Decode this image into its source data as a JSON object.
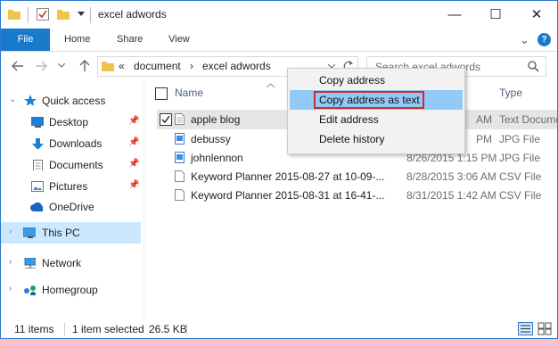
{
  "window": {
    "title": "excel adwords",
    "minimize_glyph": "—",
    "maximize_glyph": "☐",
    "close_glyph": "✕"
  },
  "ribbon": {
    "tabs": [
      "File",
      "Home",
      "Share",
      "View"
    ],
    "expand_glyph": "⌄",
    "help_glyph": "?"
  },
  "address": {
    "overflow": "«",
    "crumbs": [
      "document",
      "excel adwords"
    ],
    "separator": "›",
    "search_placeholder": "Search excel adwords"
  },
  "nav": {
    "quick_access": "Quick access",
    "items": [
      "Desktop",
      "Downloads",
      "Documents",
      "Pictures"
    ],
    "onedrive": "OneDrive",
    "this_pc": "This PC",
    "network": "Network",
    "homegroup": "Homegroup"
  },
  "list": {
    "col_name": "Name",
    "col_type": "Type",
    "files": [
      {
        "name": "apple blog",
        "date": "AM",
        "type": "Text Document",
        "icon": "text-file-icon",
        "selected": true
      },
      {
        "name": "debussy",
        "date": "PM",
        "type": "JPG File",
        "icon": "image-file-icon",
        "selected": false
      },
      {
        "name": "johnlennon",
        "date": "8/26/2015 1:15 PM",
        "type": "JPG File",
        "icon": "image-file-icon",
        "selected": false
      },
      {
        "name": "Keyword Planner 2015-08-27 at 10-09-...",
        "date": "8/28/2015 3:06 AM",
        "type": "CSV File",
        "icon": "document-file-icon",
        "selected": false
      },
      {
        "name": "Keyword Planner 2015-08-31 at 16-41-...",
        "date": "8/31/2015 1:42 AM",
        "type": "CSV File",
        "icon": "document-file-icon",
        "selected": false
      }
    ]
  },
  "context_menu": {
    "items": [
      "Copy address",
      "Copy address as text",
      "Edit address",
      "Delete history"
    ],
    "highlighted_index": 1
  },
  "status": {
    "items_count": "11 items",
    "selection": "1 item selected",
    "size": "26.5 KB"
  },
  "colors": {
    "accent": "#1979ca",
    "selection_blue": "#cce8ff",
    "menu_highlight": "#91c9f7",
    "callout_red": "#d32a2a"
  }
}
